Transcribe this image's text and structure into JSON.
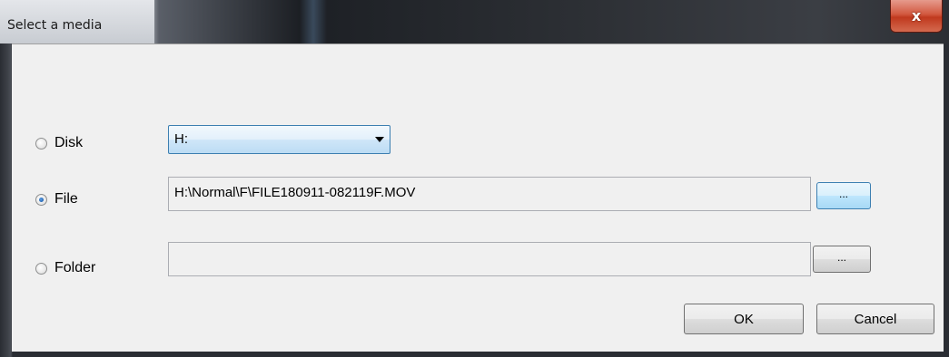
{
  "window": {
    "title": "Select a media",
    "close_label": "x"
  },
  "options": {
    "disk_label": "Disk",
    "file_label": "File",
    "folder_label": "Folder",
    "selected": "File"
  },
  "disk_select": {
    "value": "H:"
  },
  "file_input": {
    "value": "H:\\Normal\\F\\FILE180911-082119F.MOV",
    "browse_label": "..."
  },
  "folder_input": {
    "value": "",
    "browse_label": "..."
  },
  "buttons": {
    "ok_label": "OK",
    "cancel_label": "Cancel"
  },
  "colors": {
    "accent": "#3c7fb1",
    "close_red": "#c0391e",
    "client_bg": "#f0f0f0"
  }
}
